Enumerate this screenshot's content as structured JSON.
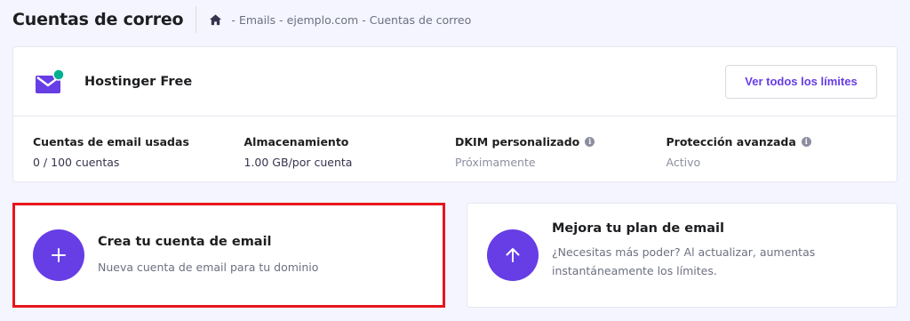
{
  "header": {
    "title": "Cuentas de correo",
    "breadcrumb": [
      "Emails",
      "ejemplo.com",
      "Cuentas de correo"
    ]
  },
  "plan": {
    "name": "Hostinger Free",
    "limits_button": "Ver todos los límites",
    "stats": [
      {
        "label": "Cuentas de email usadas",
        "value": "0 / 100 cuentas",
        "info": false
      },
      {
        "label": "Almacenamiento",
        "value": "1.00 GB/por cuenta",
        "info": false
      },
      {
        "label": "DKIM personalizado",
        "value": "Próximamente",
        "info": true
      },
      {
        "label": "Protección avanzada",
        "value": "Activo",
        "info": true
      }
    ]
  },
  "create_card": {
    "title": "Crea tu cuenta de email",
    "description": "Nueva cuenta de email para tu dominio"
  },
  "upgrade_card": {
    "title": "Mejora tu plan de email",
    "description": "¿Necesitas más poder? Al actualizar, aumentas instantáneamente los límites."
  },
  "colors": {
    "accent": "#673de6",
    "background": "#f4f5ff",
    "highlight_border": "#e8151d",
    "status_dot": "#00b090"
  }
}
